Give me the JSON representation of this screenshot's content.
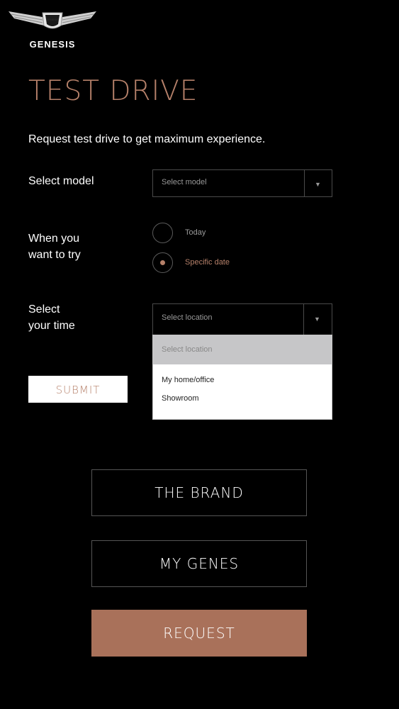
{
  "brand": {
    "name": "GENESIS",
    "seal_text": "GENESIS"
  },
  "page": {
    "title": "TEST DRIVE",
    "intro": "Request test drive to get maximum experience."
  },
  "form": {
    "model": {
      "label": "Select model",
      "value": "Select model"
    },
    "when": {
      "label_line1": "When you",
      "label_line2": "want to try",
      "options": [
        {
          "label": "Today",
          "selected": false
        },
        {
          "label": "Specific date",
          "selected": true
        }
      ]
    },
    "time": {
      "label_line1": "Select",
      "label_line2": "your time",
      "value": "Select location",
      "dropdown": {
        "header": "Select location",
        "options": [
          "My home/office",
          "Showroom"
        ]
      }
    },
    "submit_label": "SUBMIT"
  },
  "nav": {
    "brand_label": "THE BRAND",
    "genes_label": "MY GENES",
    "request_label": "REQUEST"
  },
  "colors": {
    "accent": "#b6816a",
    "request_bg": "#a9715a",
    "background": "#000000"
  },
  "icons": {
    "select_arrow": "chevron-down-icon",
    "logo": "genesis-wings-logo"
  }
}
